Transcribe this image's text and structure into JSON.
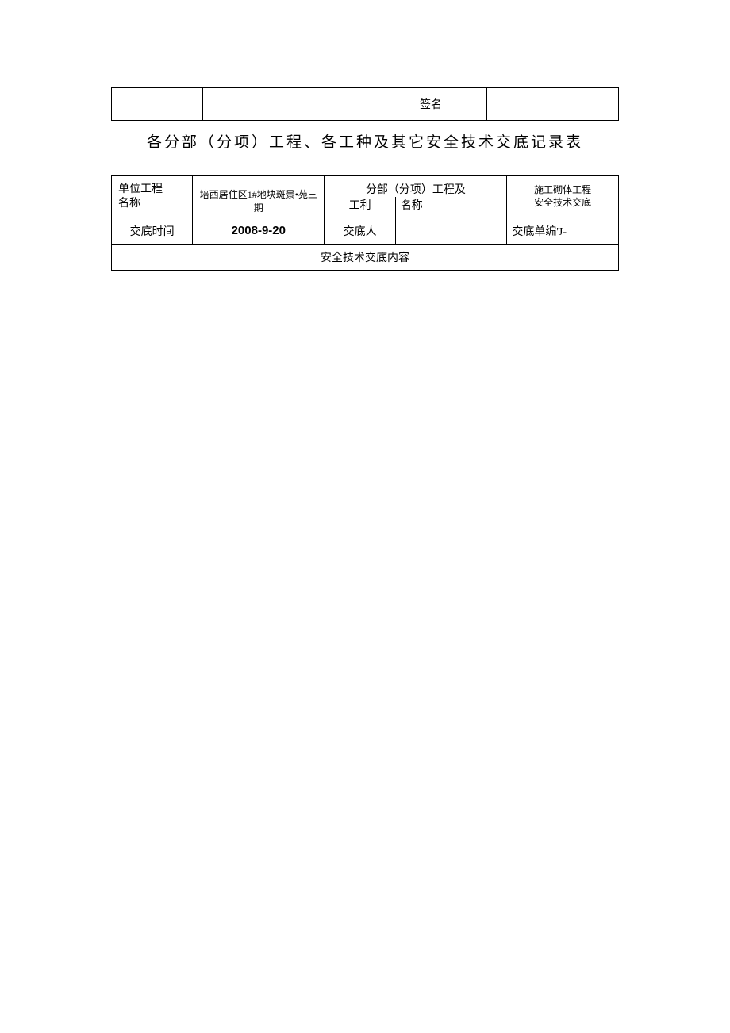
{
  "topRow": {
    "signatureLabel": "签名"
  },
  "title": "各分部（分项）工程、各工种及其它安全技术交底记录表",
  "row1": {
    "label_line1": "单位工程",
    "label_line2": "名称",
    "value": "培西居住区1#地块斑景•苑三期",
    "mid_line1": "分部（分项）工程及",
    "mid_left": "工利",
    "mid_right": "名称",
    "right_line1": "施工砌体工程",
    "right_line2": "安全技术交底"
  },
  "row2": {
    "label": "交底时间",
    "date": "2008-9-20",
    "personLabel": "交底人",
    "personValue": "",
    "unitLabel": "交底单编'J-"
  },
  "row3": {
    "heading": "安全技术交底内容"
  }
}
